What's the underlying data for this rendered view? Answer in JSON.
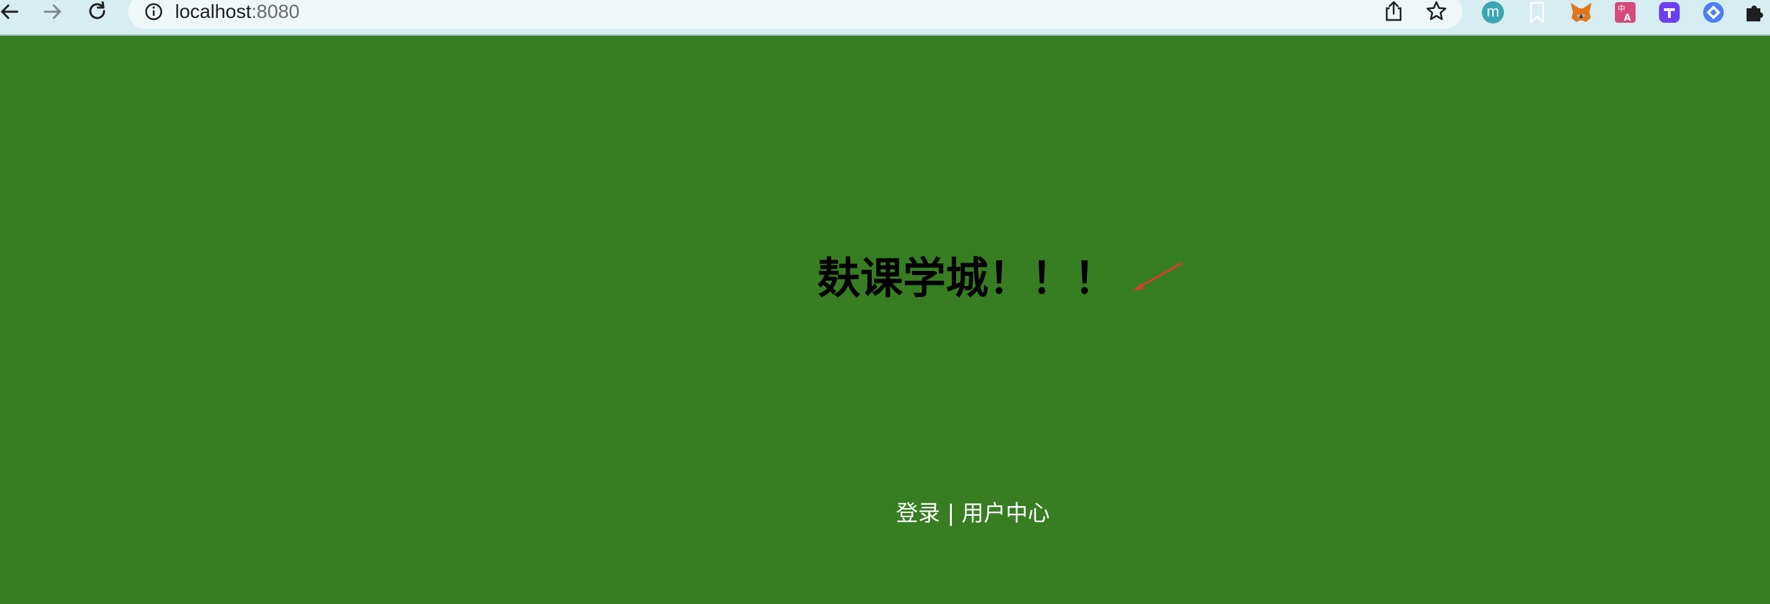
{
  "browser": {
    "url_host": "localhost",
    "url_port": ":8080",
    "colors": {
      "toolbar_bg": "#d6edf1",
      "omnibox_bg": "#eff7f9",
      "page_bg": "#377e22"
    },
    "icons": {
      "back": "back-arrow-icon",
      "forward": "forward-arrow-icon",
      "reload": "reload-icon",
      "info": "info-icon",
      "share": "share-icon",
      "bookmark_star": "star-icon",
      "profile_letter": "m",
      "extensions": [
        "bookmark-icon",
        "metamask-fox-icon",
        "translate-icon",
        "shopping-icon",
        "diamond-extension-icon",
        "puzzle-icon"
      ]
    }
  },
  "page": {
    "title": "麸课学城！！！",
    "login_link": "登录",
    "separator": "|",
    "user_center_link": "用户中心",
    "annotation_arrow_color": "#e03a2a"
  }
}
